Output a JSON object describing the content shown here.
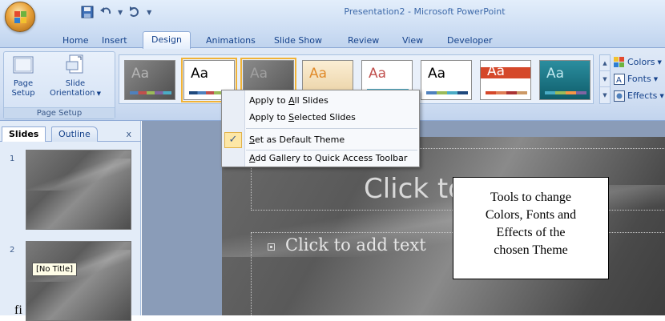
{
  "window": {
    "title": "Presentation2 - Microsoft PowerPoint"
  },
  "ribbon_tabs": [
    "Home",
    "Insert",
    "Design",
    "Animations",
    "Slide Show",
    "Review",
    "View",
    "Developer"
  ],
  "active_tab": "Design",
  "page_setup": {
    "page_setup_line1": "Page",
    "page_setup_line2": "Setup",
    "slide_orientation_line1": "Slide",
    "slide_orientation_line2": "Orientation",
    "group_label": "Page Setup"
  },
  "themes": [
    {
      "label": "Aa",
      "bg": "#6b6b6b",
      "fg": "#a9a9a9"
    },
    {
      "label": "Aa",
      "bg": "#ffffff",
      "fg": "#000000"
    },
    {
      "label": "Aa",
      "bg": "#6f6f6f",
      "fg": "#9b9b9b"
    },
    {
      "label": "Aa",
      "bg": "#f2e3c5",
      "fg": "#e08a2a"
    },
    {
      "label": "Aa",
      "bg": "#ffffff",
      "fg": "#c0504d"
    },
    {
      "label": "Aa",
      "bg": "#ffffff",
      "fg": "#000000"
    },
    {
      "label": "Aa",
      "bg": "#ffffff",
      "fg": "#ffffff"
    },
    {
      "label": "Aa",
      "bg": "#1c7a8a",
      "fg": "#bfe8ef"
    }
  ],
  "theme_tools": {
    "colors": "Colors",
    "fonts": "Fonts",
    "effects": "Effects"
  },
  "context_menu": {
    "item1_pre": "Apply to ",
    "item1_key": "A",
    "item1_post": "ll Slides",
    "item2_pre": "Apply to ",
    "item2_key": "S",
    "item2_post": "elected Slides",
    "item3_pre": "",
    "item3_key": "S",
    "item3_post": "et as Default Theme",
    "item4_pre": "",
    "item4_key": "A",
    "item4_post": "dd Gallery to Quick Access Toolbar",
    "check_mark": "✓"
  },
  "slide_pane": {
    "tab_slides": "Slides",
    "tab_outline": "Outline",
    "close": "x",
    "slide1_num": "1",
    "slide2_num": "2",
    "tooltip": "[No Title]",
    "stray_text": "fi"
  },
  "slide": {
    "title_placeholder": "Click to add title",
    "body_placeholder": "Click to add text"
  },
  "callout": {
    "line1": "Tools to change",
    "line2": "Colors, Fonts and",
    "line3": "Effects of the",
    "line4": "chosen Theme"
  },
  "colors": {
    "ribbon_bg": "#d0def2",
    "selected_outline": "#f1b337",
    "menu_check_bg": "#fde7a6"
  }
}
